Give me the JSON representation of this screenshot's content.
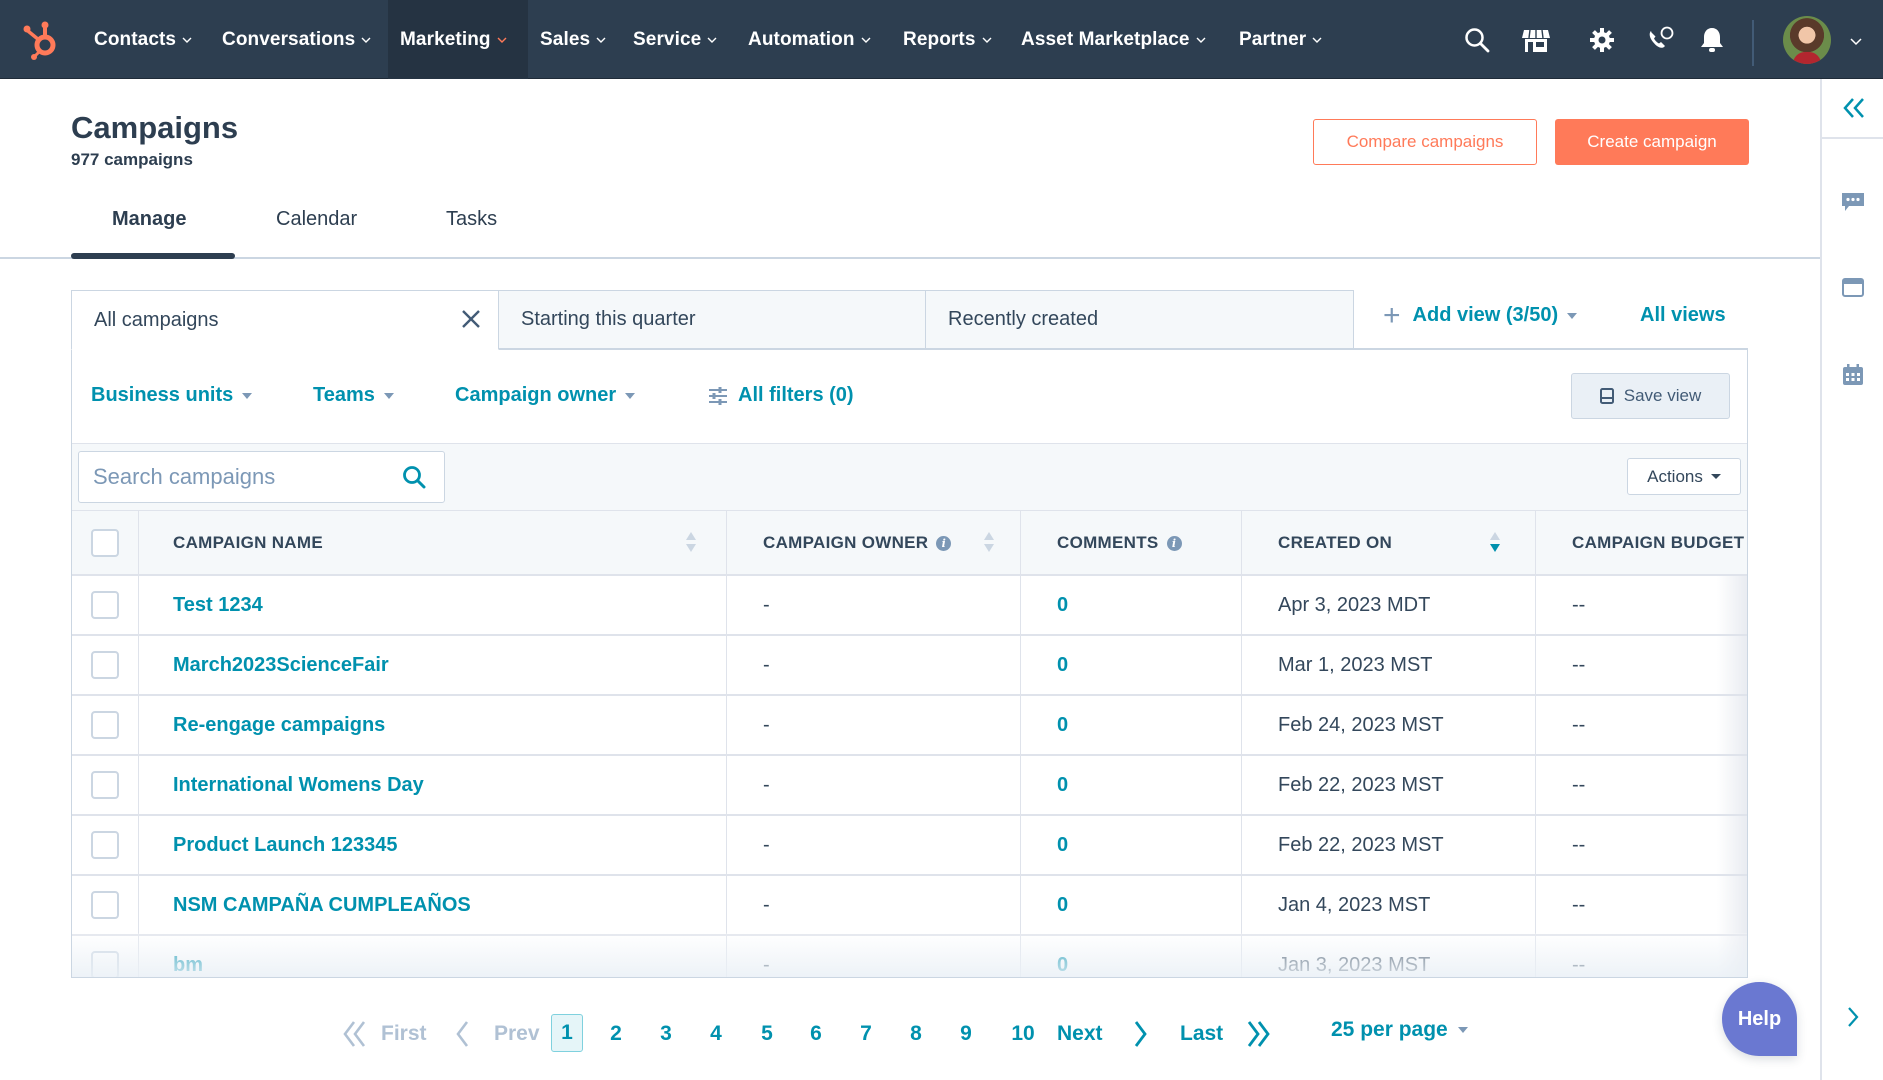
{
  "nav": {
    "logo_icon": "hubspot-sprocket-icon",
    "items": [
      {
        "label": "Contacts",
        "active": false
      },
      {
        "label": "Conversations",
        "active": false
      },
      {
        "label": "Marketing",
        "active": true
      },
      {
        "label": "Sales",
        "active": false
      },
      {
        "label": "Service",
        "active": false
      },
      {
        "label": "Automation",
        "active": false
      },
      {
        "label": "Reports",
        "active": false
      },
      {
        "label": "Asset Marketplace",
        "active": false
      },
      {
        "label": "Partner",
        "active": false
      }
    ],
    "icons": [
      "search-icon",
      "marketplace-icon",
      "settings-gear-icon",
      "calling-icon",
      "notifications-bell-icon"
    ],
    "colors": {
      "nav_bg": "#2d3e50",
      "active_bg": "#253342",
      "accent": "#ff7a59"
    }
  },
  "page": {
    "title": "Campaigns",
    "subtitle": "977 campaigns",
    "buttons": {
      "compare": "Compare campaigns",
      "create": "Create campaign"
    },
    "tabs": [
      {
        "label": "Manage",
        "active": true
      },
      {
        "label": "Calendar",
        "active": false
      },
      {
        "label": "Tasks",
        "active": false
      }
    ]
  },
  "views": {
    "tabs": [
      {
        "label": "All campaigns",
        "active": true,
        "closable": true
      },
      {
        "label": "Starting this quarter",
        "active": false
      },
      {
        "label": "Recently created",
        "active": false
      }
    ],
    "add_view": "Add view (3/50)",
    "all_views": "All views"
  },
  "filters": {
    "items": [
      "Business units",
      "Teams",
      "Campaign owner"
    ],
    "all_filters": "All filters (0)",
    "save_view": "Save view"
  },
  "search": {
    "placeholder": "Search campaigns",
    "value": ""
  },
  "actions_label": "Actions",
  "table": {
    "columns": [
      {
        "label": "CAMPAIGN NAME",
        "info": false,
        "sort": "none"
      },
      {
        "label": "CAMPAIGN OWNER",
        "info": true,
        "sort": "none"
      },
      {
        "label": "COMMENTS",
        "info": true,
        "sort": null
      },
      {
        "label": "CREATED ON",
        "info": false,
        "sort": "desc"
      },
      {
        "label": "CAMPAIGN BUDGET",
        "info": false,
        "sort": null
      }
    ],
    "rows": [
      {
        "name": "Test 1234",
        "owner": "-",
        "comments": "0",
        "created": "Apr 3, 2023 MDT",
        "budget": "--"
      },
      {
        "name": "March2023ScienceFair",
        "owner": "-",
        "comments": "0",
        "created": "Mar 1, 2023 MST",
        "budget": "--"
      },
      {
        "name": "Re-engage campaigns",
        "owner": "-",
        "comments": "0",
        "created": "Feb 24, 2023 MST",
        "budget": "--"
      },
      {
        "name": "International Womens Day",
        "owner": "-",
        "comments": "0",
        "created": "Feb 22, 2023 MST",
        "budget": "--"
      },
      {
        "name": "Product Launch 123345",
        "owner": "-",
        "comments": "0",
        "created": "Feb 22, 2023 MST",
        "budget": "--"
      },
      {
        "name": "NSM CAMPAÑA CUMPLEAÑOS",
        "owner": "-",
        "comments": "0",
        "created": "Jan 4, 2023 MST",
        "budget": "--"
      },
      {
        "name": "bm",
        "owner": "-",
        "comments": "0",
        "created": "Jan 3, 2023 MST",
        "budget": "--"
      }
    ]
  },
  "pagination": {
    "first": "First",
    "prev": "Prev",
    "pages": [
      "1",
      "2",
      "3",
      "4",
      "5",
      "6",
      "7",
      "8",
      "9",
      "10"
    ],
    "current": "1",
    "next": "Next",
    "last": "Last",
    "per_page": "25 per page"
  },
  "help_label": "Help",
  "right_sidebar": {
    "icons": [
      "collapse-double-chevron-icon",
      "chat-icon",
      "browser-window-icon",
      "calendar-icon",
      "expand-chevron-icon"
    ]
  }
}
